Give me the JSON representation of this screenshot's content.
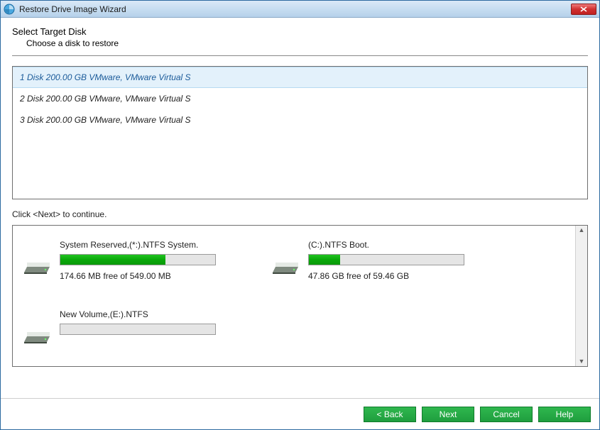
{
  "window": {
    "title": "Restore Drive Image Wizard"
  },
  "page": {
    "heading": "Select Target Disk",
    "subheading": "Choose a disk to restore",
    "instruction": "Click <Next> to continue."
  },
  "disks": [
    {
      "label": "1 Disk 200.00 GB VMware,  VMware Virtual S",
      "selected": true
    },
    {
      "label": "2 Disk 200.00 GB VMware,  VMware Virtual S",
      "selected": false
    },
    {
      "label": "3 Disk 200.00 GB VMware,  VMware Virtual S",
      "selected": false
    }
  ],
  "partitions": [
    {
      "label": "System Reserved,(*:).NTFS System.",
      "free_text": "174.66 MB free of 549.00 MB",
      "fill_percent": 68
    },
    {
      "label": "(C:).NTFS Boot.",
      "free_text": "47.86 GB free of 59.46 GB",
      "fill_percent": 20
    },
    {
      "label": "New Volume,(E:).NTFS",
      "free_text": "",
      "fill_percent": 0
    }
  ],
  "buttons": {
    "back": "< Back",
    "next": "Next",
    "cancel": "Cancel",
    "help": "Help"
  }
}
